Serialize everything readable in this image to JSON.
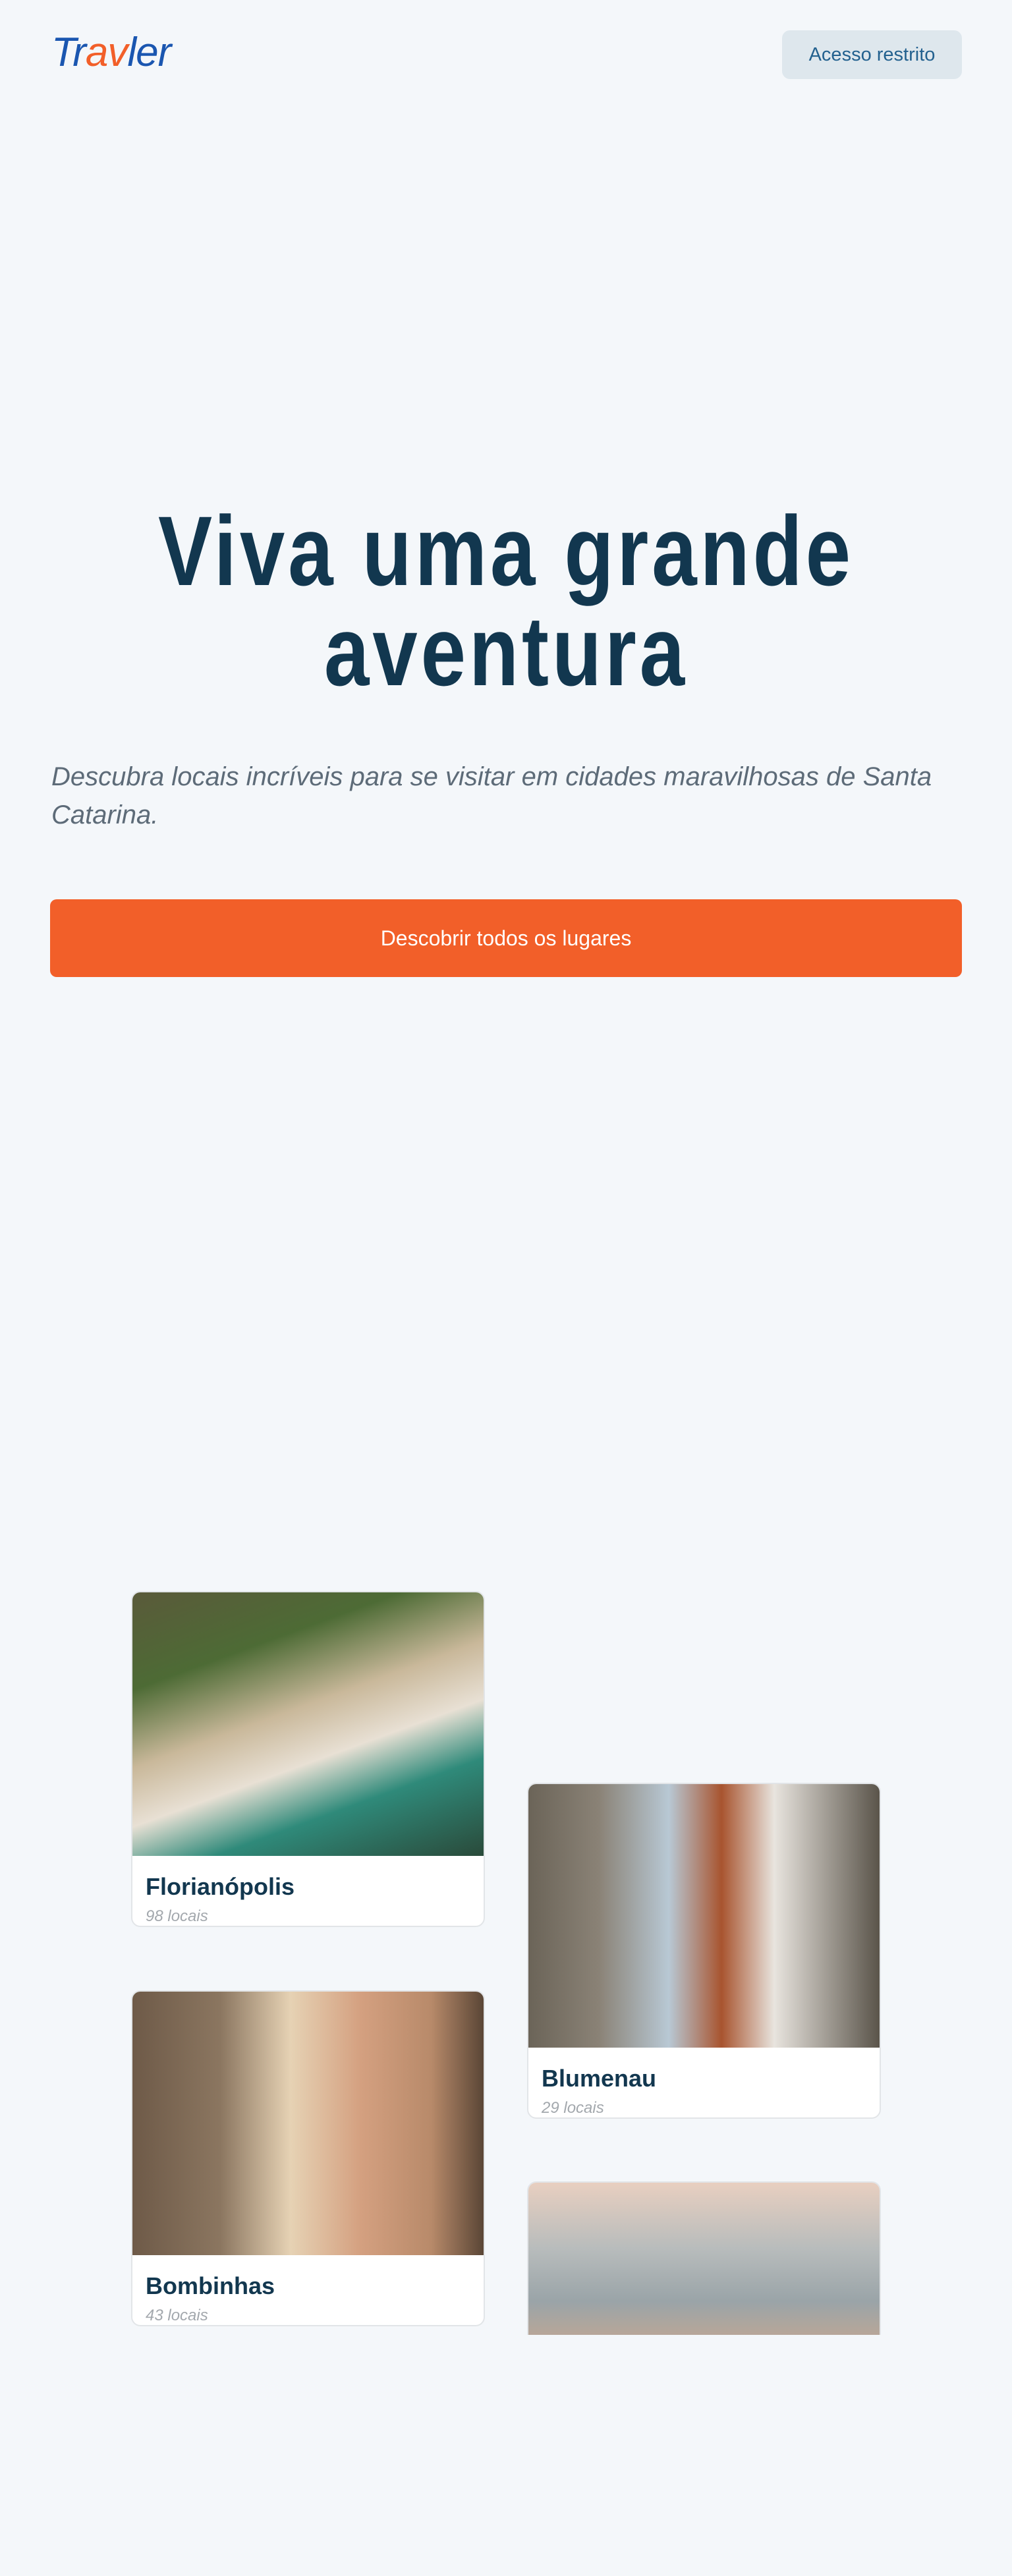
{
  "header": {
    "logo": {
      "p1": "Tr",
      "p2": "av",
      "p3": "ler"
    },
    "access_label": "Acesso restrito"
  },
  "hero": {
    "title": "Viva uma grande aventura",
    "subtitle": "Descubra locais incríveis para se visitar em cidades maravilhosas de Santa Catarina.",
    "cta_label": "Descobrir todos os lugares"
  },
  "colors": {
    "brand": "#1a56b0",
    "accent": "#f25f29",
    "heading": "#12374f"
  },
  "cities": [
    {
      "name": "Florianópolis",
      "count": "98 locais"
    },
    {
      "name": "Blumenau",
      "count": "29 locais"
    },
    {
      "name": "Bombinhas",
      "count": "43 locais"
    }
  ]
}
